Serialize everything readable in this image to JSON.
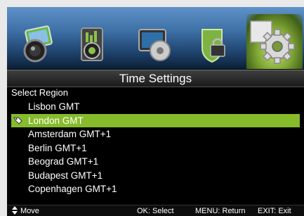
{
  "menu": {
    "icons": [
      {
        "name": "picture-icon",
        "selected": false
      },
      {
        "name": "sound-icon",
        "selected": false
      },
      {
        "name": "channel-icon",
        "selected": false
      },
      {
        "name": "lock-icon",
        "selected": false
      },
      {
        "name": "settings-gear-icon",
        "selected": true
      }
    ],
    "title": "Time Settings"
  },
  "region": {
    "label": "Select Region",
    "items": [
      {
        "label": "Lisbon GMT",
        "selected": false
      },
      {
        "label": "London GMT",
        "selected": true
      },
      {
        "label": "Amsterdam GMT+1",
        "selected": false
      },
      {
        "label": "Berlin GMT+1",
        "selected": false
      },
      {
        "label": "Beograd GMT+1",
        "selected": false
      },
      {
        "label": "Budapest GMT+1",
        "selected": false
      },
      {
        "label": "Copenhagen GMT+1",
        "selected": false
      }
    ]
  },
  "footer": {
    "move": "Move",
    "ok": "OK: Select",
    "menu": "MENU: Return",
    "exit": "EXIT: Exit"
  },
  "colors": {
    "highlight": "#86bb2c",
    "background": "#000000",
    "icon_bar": "#3c6ea4"
  }
}
